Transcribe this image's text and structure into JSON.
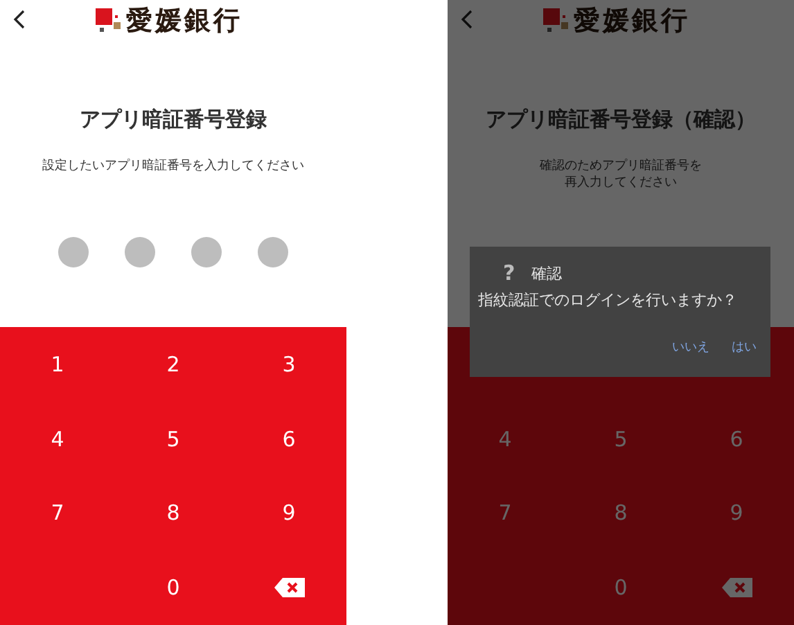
{
  "screens": [
    {
      "dimmed": false,
      "logo_text": "愛媛銀行",
      "title": "アプリ暗証番号登録",
      "instruction": [
        "設定したいアプリ暗証番号を入力してください"
      ],
      "pin_dots": [
        {
          "filled": false
        },
        {
          "filled": false
        },
        {
          "filled": false
        },
        {
          "filled": false
        }
      ],
      "keys": [
        {
          "kind": "digit",
          "label": "1"
        },
        {
          "kind": "digit",
          "label": "2"
        },
        {
          "kind": "digit",
          "label": "3"
        },
        {
          "kind": "digit",
          "label": "4"
        },
        {
          "kind": "digit",
          "label": "5"
        },
        {
          "kind": "digit",
          "label": "6"
        },
        {
          "kind": "digit",
          "label": "7"
        },
        {
          "kind": "digit",
          "label": "8"
        },
        {
          "kind": "digit",
          "label": "9"
        },
        {
          "kind": "blank"
        },
        {
          "kind": "digit",
          "label": "0"
        },
        {
          "kind": "backspace"
        }
      ]
    },
    {
      "dimmed": true,
      "logo_text": "愛媛銀行",
      "title": "アプリ暗証番号登録（確認）",
      "instruction": [
        "確認のためアプリ暗証番号を",
        "再入力してください"
      ],
      "keys": [
        {
          "kind": "blank"
        },
        {
          "kind": "blank"
        },
        {
          "kind": "blank"
        },
        {
          "kind": "digit",
          "label": "4"
        },
        {
          "kind": "digit",
          "label": "5"
        },
        {
          "kind": "digit",
          "label": "6"
        },
        {
          "kind": "digit",
          "label": "7"
        },
        {
          "kind": "digit",
          "label": "8"
        },
        {
          "kind": "digit",
          "label": "9"
        },
        {
          "kind": "blank"
        },
        {
          "kind": "digit",
          "label": "0"
        },
        {
          "kind": "backspace"
        }
      ],
      "dialog": {
        "icon": "?",
        "title": "確認",
        "message": "指紋認証でのログインを行いますか？",
        "buttons": [
          "いいえ",
          "はい"
        ]
      }
    }
  ]
}
